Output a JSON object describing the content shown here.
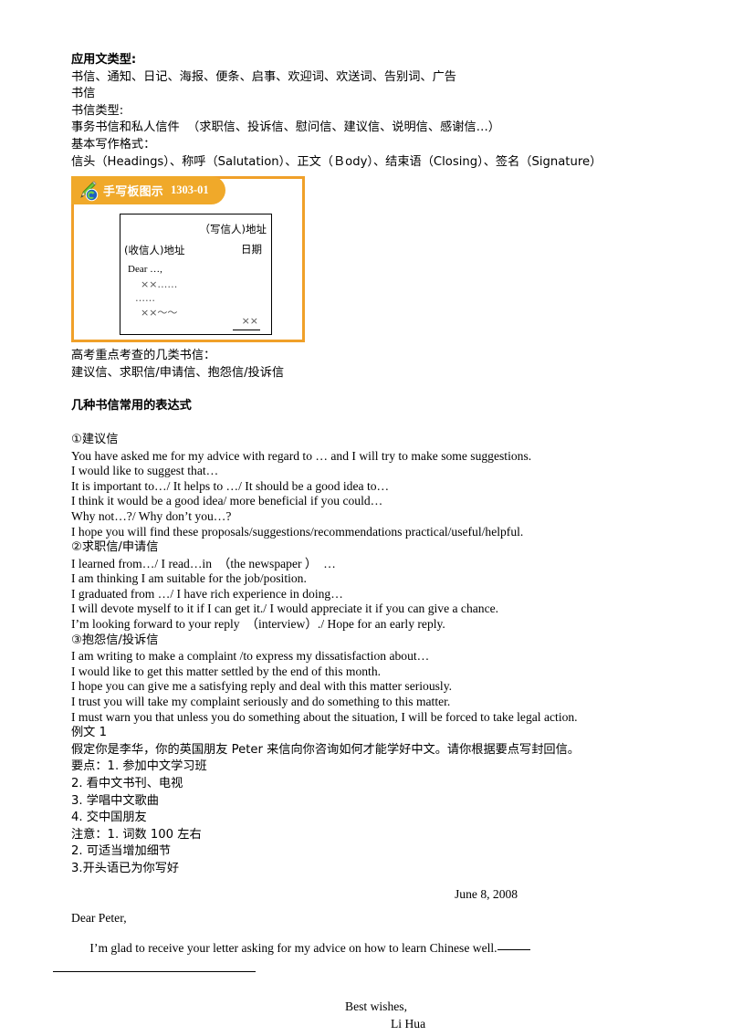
{
  "document": {
    "section_types": {
      "heading": "应用文类型:",
      "lines": [
        "书信、通知、日记、海报、便条、启事、欢迎词、欢送词、告别词、广告",
        "书信",
        "书信类型:",
        "事务书信和私人信件  （求职信、投诉信、慰问信、建议信、说明信、感谢信…）",
        "基本写作格式：",
        "信头（Headings）、称呼（Salutation）、正文（Ｂody）、结束语（Closing）、签名（Signature）"
      ]
    },
    "illustration": {
      "tab_title": "手写板图示",
      "tab_code": "1303-01",
      "pencil_icon": "pencil-icon",
      "swirl_icon": "swirl-logo-icon",
      "sketch": {
        "sender_address": "（写信人)地址",
        "recipient_address": "(收信人)地址",
        "date": "日期",
        "salutation": "Dear …,",
        "body_line_1": "××……",
        "body_line_2": "……",
        "body_line_3": "××〜〜",
        "signature": "××"
      }
    },
    "exam_focus": {
      "line1": "高考重点考查的几类书信：",
      "line2": "建议信、求职信/申请信、抱怨信/投诉信"
    },
    "expressions": {
      "heading": "几种书信常用的表达式",
      "groups": [
        {
          "title": "①建议信",
          "lines": [
            "You have asked me for my advice with regard to … and I will try to make some suggestions.",
            "I would like to suggest that…",
            "It is important to…/ It helps to …/ It should be a good idea to…",
            "I think it would be a good idea/ more beneficial if you could…",
            "Why not…?/ Why don’t you…?",
            "I hope you will find these proposals/suggestions/recommendations practical/useful/helpful."
          ]
        },
        {
          "title": "②求职信/申请信",
          "lines": [
            "I learned from…/ I read…in  （the newspaper ）  …",
            "I am thinking I am suitable for the job/position.",
            "I graduated from …/ I have rich experience in doing…",
            "I will devote myself to it if I can get it./ I would appreciate it if you can give a chance.",
            "I’m looking forward to your reply  （interview）./ Hope for an early reply."
          ]
        },
        {
          "title": "③抱怨信/投诉信",
          "lines": [
            "I am writing to make a complaint /to express my dissatisfaction about…",
            "I would like to get this matter settled by the end of this month.",
            "I hope you can give me a satisfying reply and deal with this matter seriously.",
            "I trust you will take my complaint seriously and do something to this matter.",
            "I must warn you that unless you do something about the situation, I will be forced to take legal action."
          ]
        }
      ]
    },
    "example": {
      "label": "例文 1",
      "prompt": "假定你是李华，你的英国朋友 Peter 来信向你咨询如何才能学好中文。请你根据要点写封回信。",
      "points": [
        "要点：1. 参加中文学习班",
        "2. 看中文书刊、电视",
        "3. 学唱中文歌曲",
        "4. 交中国朋友"
      ],
      "notes": [
        "注意：1. 词数 100 左右",
        "2. 可适当增加细节",
        "3.开头语已为你写好"
      ],
      "letter": {
        "date": "June 8, 2008",
        "salutation": "Dear Peter,",
        "opening": "I’m glad to receive your letter asking for my advice on how to learn Chinese well.",
        "closing": "Best wishes,",
        "signature": "Li Hua"
      }
    }
  },
  "colors": {
    "tab_orange": "#f0a92a",
    "border_orange": "#f0a029",
    "pencil_green": "#5bbf2f",
    "swirl_blue": "#1f5fc0",
    "text_black": "#000000"
  }
}
